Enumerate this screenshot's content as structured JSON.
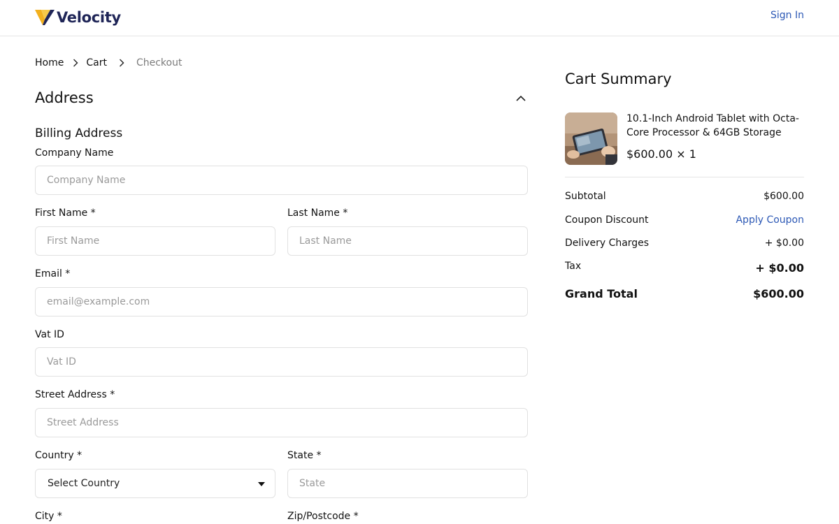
{
  "header": {
    "brand": "Velocity",
    "sign_in": "Sign In"
  },
  "breadcrumb": {
    "items": [
      "Home",
      "Cart",
      "Checkout"
    ]
  },
  "address_section": {
    "title": "Address",
    "billing_title": "Billing Address",
    "fields": {
      "company": {
        "label": "Company Name",
        "placeholder": "Company Name"
      },
      "first_name": {
        "label": "First Name *",
        "placeholder": "First Name"
      },
      "last_name": {
        "label": "Last Name *",
        "placeholder": "Last Name"
      },
      "email": {
        "label": "Email *",
        "placeholder": "email@example.com"
      },
      "vat": {
        "label": "Vat ID",
        "placeholder": "Vat ID"
      },
      "street": {
        "label": "Street Address *",
        "placeholder": "Street Address"
      },
      "country": {
        "label": "Country *",
        "value": "Select Country"
      },
      "state": {
        "label": "State *",
        "placeholder": "State"
      },
      "city": {
        "label": "City *"
      },
      "zip": {
        "label": "Zip/Postcode *"
      }
    }
  },
  "cart_summary": {
    "title": "Cart Summary",
    "product": {
      "name": "10.1-Inch Android Tablet with Octa-Core Processor & 64GB Storage",
      "price_qty": "$600.00 × 1"
    },
    "rows": {
      "subtotal": {
        "label": "Subtotal",
        "value": "$600.00"
      },
      "coupon": {
        "label": "Coupon Discount",
        "value": "Apply Coupon"
      },
      "delivery": {
        "label": "Delivery Charges",
        "value": "+ $0.00"
      },
      "tax": {
        "label": "Tax",
        "value": "+ $0.00"
      },
      "grand_total": {
        "label": "Grand Total",
        "value": "$600.00"
      }
    }
  },
  "colors": {
    "brand_navy": "#1f2557",
    "link_blue": "#2c58b5",
    "logo_gold": "#f2b01e",
    "border": "#e1e1e1"
  },
  "icons": {
    "logo": "velocity-v-logo-icon",
    "breadcrumb_separator": "chevron-right-icon",
    "collapse": "chevron-up-icon",
    "select": "caret-down-icon"
  }
}
